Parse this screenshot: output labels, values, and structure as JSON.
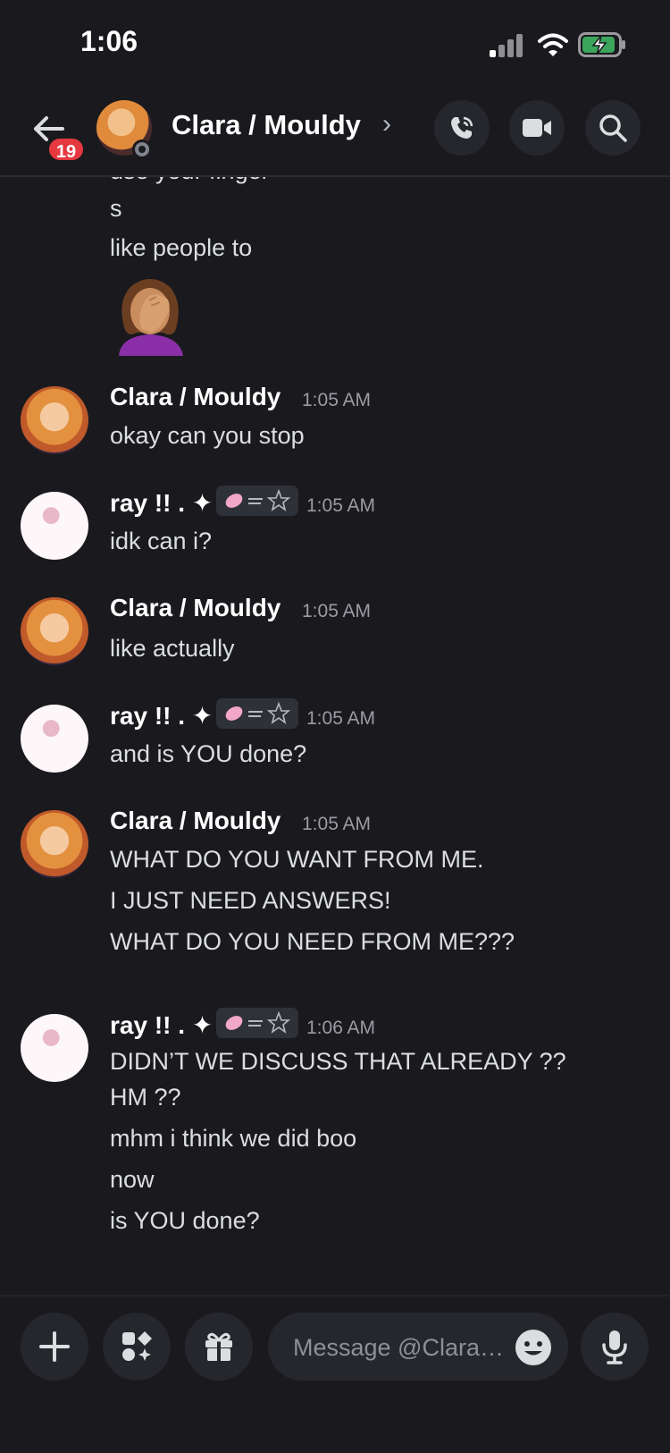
{
  "status_bar": {
    "time": "1:06"
  },
  "header": {
    "title": "Clara / Mouldy",
    "chevron": "›",
    "unread_badge": "19",
    "buttons": [
      "phone-call-icon",
      "video-icon",
      "search-icon"
    ]
  },
  "partial_messages": [
    "use your finger",
    "s",
    "like people to"
  ],
  "messages": [
    {
      "author": "Clara / Mouldy",
      "time": "1:05 AM",
      "lines": [
        "okay can you stop"
      ]
    },
    {
      "author": "ray !! . ✦",
      "time": "1:05 AM",
      "lines": [
        "idk can i?"
      ]
    },
    {
      "author": "Clara / Mouldy",
      "time": "1:05 AM",
      "lines": [
        "like actually"
      ]
    },
    {
      "author": "ray !! . ✦",
      "time": "1:05 AM",
      "lines": [
        "and is YOU done?"
      ]
    },
    {
      "author": "Clara / Mouldy",
      "time": "1:05 AM",
      "lines": [
        "WHAT DO YOU WANT FROM ME.",
        "I JUST NEED ANSWERS!",
        "WHAT DO YOU NEED FROM ME???"
      ]
    },
    {
      "author": "ray !! . ✦",
      "time": "1:06 AM",
      "lines": [
        "DIDN’T WE DISCUSS THAT ALREADY ??",
        "HM ??",
        "mhm i think we did boo",
        "now",
        "is YOU done?"
      ]
    }
  ],
  "composer": {
    "placeholder": "Message @Clara…",
    "buttons": [
      "plus-icon",
      "apps-icon",
      "gift-icon",
      "emoji-icon",
      "microphone-icon"
    ]
  },
  "colors": {
    "background": "#1a1a1e",
    "badge": "#e5383f",
    "battery": "#3ba55c"
  }
}
